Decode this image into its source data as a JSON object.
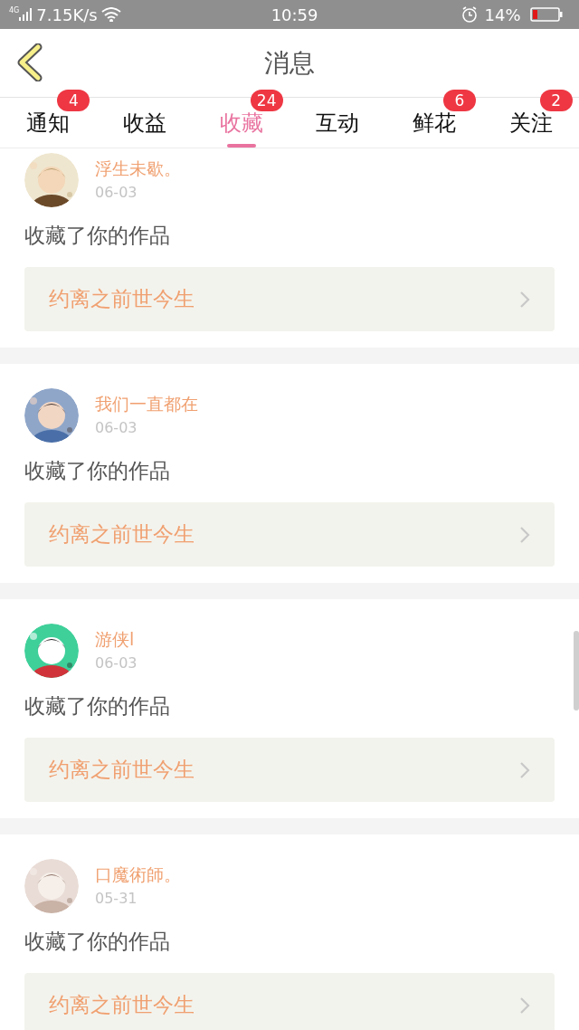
{
  "status_bar": {
    "network": "4G",
    "speed": "7.15K/s",
    "time": "10:59",
    "battery": "14%"
  },
  "header": {
    "title": "消息"
  },
  "tabs": [
    {
      "label": "通知",
      "badge": "4",
      "selected": false
    },
    {
      "label": "收益",
      "selected": false
    },
    {
      "label": "收藏",
      "badge": "24",
      "selected": true
    },
    {
      "label": "互动",
      "selected": false
    },
    {
      "label": "鲜花",
      "badge": "6",
      "selected": false
    },
    {
      "label": "关注",
      "badge": "2",
      "selected": false
    }
  ],
  "messages": [
    {
      "user": "浮生未歇。",
      "date": "06-03",
      "action": "收藏了你的作品",
      "work": "约离之前世今生"
    },
    {
      "user": "我们一直都在",
      "date": "06-03",
      "action": "收藏了你的作品",
      "work": "约离之前世今生"
    },
    {
      "user": "游侠l",
      "date": "06-03",
      "action": "收藏了你的作品",
      "work": "约离之前世今生"
    },
    {
      "user": "口魔術師。",
      "date": "05-31",
      "action": "收藏了你的作品",
      "work": "约离之前世今生"
    }
  ]
}
